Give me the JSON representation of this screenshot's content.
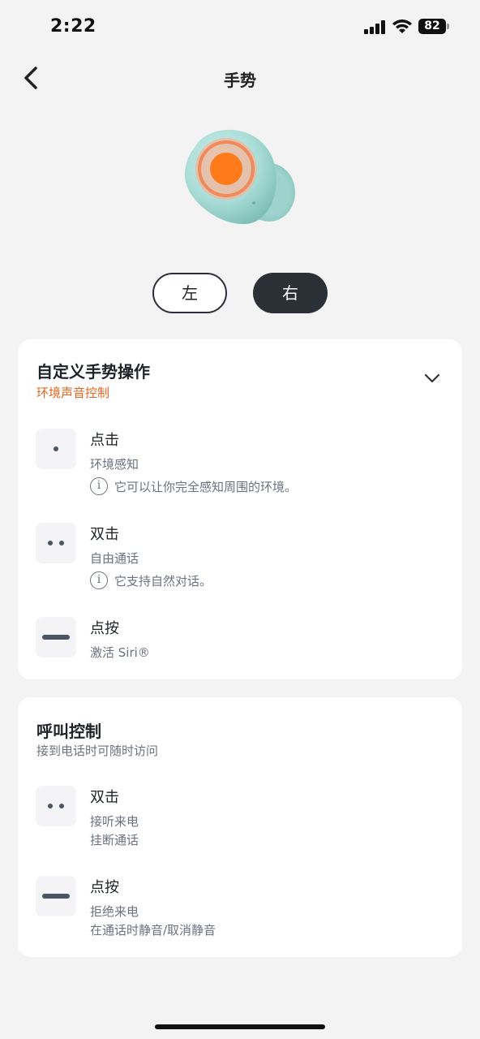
{
  "status_bar": {
    "time": "2:22",
    "battery": "82",
    "icons": [
      "signal-icon",
      "wifi-icon",
      "battery-icon"
    ]
  },
  "header": {
    "title": "手势",
    "back_icon": "chevron-left-icon"
  },
  "side_toggle": {
    "left_label": "左",
    "right_label": "右",
    "selected": "右"
  },
  "colors": {
    "accent": "#e5641e",
    "dark": "#2b2f36",
    "earbud_body": "#a9dcd6",
    "earbud_ring": "#ff7a1a"
  },
  "custom_gestures": {
    "title": "自定义手势操作",
    "subtitle": "环境声音控制",
    "expand_icon": "chevron-down-icon",
    "items": [
      {
        "icon": "single-dot-icon",
        "name": "点击",
        "action": "环境感知",
        "info": "它可以让你完全感知周围的环境。"
      },
      {
        "icon": "double-dot-icon",
        "name": "双击",
        "action": "自由通话",
        "info": "它支持自然对话。"
      },
      {
        "icon": "long-press-bar-icon",
        "name": "点按",
        "action": "激活 Siri®"
      }
    ]
  },
  "call_control": {
    "title": "呼叫控制",
    "subtitle": "接到电话时可随时访问",
    "items": [
      {
        "icon": "double-dot-icon",
        "name": "双击",
        "actions": [
          "接听来电",
          "挂断通话"
        ]
      },
      {
        "icon": "long-press-bar-icon",
        "name": "点按",
        "actions": [
          "拒绝来电",
          "在通话时静音/取消静音"
        ]
      }
    ]
  }
}
